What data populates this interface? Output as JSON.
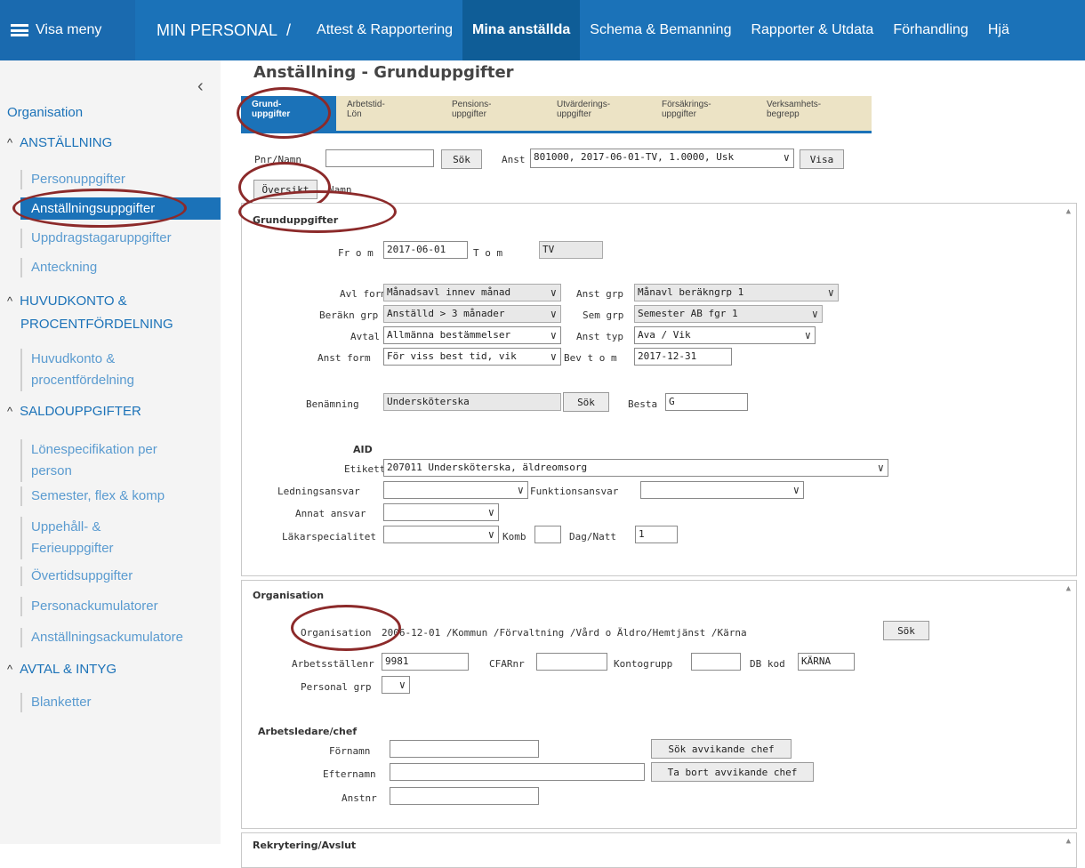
{
  "topbar": {
    "menu_label": "Visa meny",
    "app_title": "MIN PERSONAL",
    "separator": "/",
    "nav": [
      "Attest & Rapportering",
      "Mina anställda",
      "Schema & Bemanning",
      "Rapporter & Utdata",
      "Förhandling",
      "Hjä"
    ]
  },
  "sidebar": {
    "collapse": "‹",
    "organisation": "Organisation",
    "sec_anstallning": "ANSTÄLLNING",
    "personuppgifter": "Personuppgifter",
    "anstallningsuppgifter": "Anställningsuppgifter",
    "uppdragstagaruppgifter": "Uppdragstagaruppgifter",
    "anteckning": "Anteckning",
    "sec_huvudkonto_1": "HUVUDKONTO &",
    "sec_huvudkonto_2": "PROCENTFÖRDELNING",
    "huvudkonto_1": "Huvudkonto &",
    "huvudkonto_2": "procentfördelning",
    "sec_saldo": "SALDOUPPGIFTER",
    "lonespec_1": "Lönespecifikation per",
    "lonespec_2": "person",
    "semester": "Semester, flex & komp",
    "uppehall_1": "Uppehåll- &",
    "uppehall_2": "Ferieuppgifter",
    "overtid": "Övertidsuppgifter",
    "personack": "Personackumulatorer",
    "anstack": "Anställningsackumulatore",
    "sec_avtal": "AVTAL & INTYG",
    "blanketter": "Blanketter"
  },
  "page": {
    "title": "Anställning - Grunduppgifter",
    "tabs": [
      [
        "Grund-",
        "uppgifter"
      ],
      [
        "Arbetstid-",
        "Lön"
      ],
      [
        "Pensions-",
        "uppgifter"
      ],
      [
        "Utvärderings-",
        "uppgifter"
      ],
      [
        "Försäkrings-",
        "uppgifter"
      ],
      [
        "Verksamhets-",
        "begrepp"
      ]
    ],
    "pnr_label": "Pnr/Namn",
    "sok": "Sök",
    "anst_label": "Anst",
    "anst_value": "801000, 2017-06-01-TV, 1.0000, Usk",
    "visa": "Visa",
    "oversikt": "Översikt",
    "namn_label": "Namn"
  },
  "grund": {
    "header": "Grunduppgifter",
    "from_label": "Fr o m",
    "from_value": "2017-06-01",
    "tom_label": "T o m",
    "tom_value": "TV",
    "avl_form_label": "Avl form",
    "avl_form": "Månadsavl innev månad",
    "anst_grp_label": "Anst grp",
    "anst_grp": "Månavl beräkngrp 1",
    "berakn_label": "Beräkn grp",
    "berakn": "Anställd > 3 månader",
    "sem_grp_label": "Sem grp",
    "sem_grp": "Semester AB fgr 1",
    "avtal_label": "Avtal",
    "avtal": "Allmänna bestämmelser",
    "anst_typ_label": "Anst typ",
    "anst_typ": "Ava / Vik",
    "anst_form_label": "Anst form",
    "anst_form": "För viss best tid, vik",
    "bev_label": "Bev t o m",
    "bev_value": "2017-12-31",
    "benamning_label": "Benämning",
    "benamning": "Undersköterska",
    "besta_label": "Besta",
    "besta_value": "G",
    "aid_header": "AID",
    "etikett_label": "Etikett",
    "etikett": "207011 Undersköterska, äldreomsorg",
    "ledning_label": "Ledningsansvar",
    "funktion_label": "Funktionsansvar",
    "annat_label": "Annat ansvar",
    "lakar_label": "Läkarspecialitet",
    "komb_label": "Komb",
    "dagnatt_label": "Dag/Natt",
    "dagnatt_value": "1"
  },
  "org": {
    "header": "Organisation",
    "org_label": "Organisation",
    "org_value": "2006-12-01 /Kommun /Förvaltning /Vård o Äldro/Hemtjänst /Kärna",
    "arbetsst_label": "Arbetsställenr",
    "arbetsst_value": "9981",
    "cfar_label": "CFARnr",
    "kontogrupp_label": "Kontogrupp",
    "dbkod_label": "DB kod",
    "dbkod_value": "KÄRNA",
    "personal_label": "Personal grp",
    "chef_header": "Arbetsledare/chef",
    "fornamn_label": "Förnamn",
    "efternamn_label": "Efternamn",
    "anstnr_label": "Anstnr",
    "sok_chef": "Sök avvikande chef",
    "ta_bort_chef": "Ta bort avvikande chef"
  },
  "rekrytering": {
    "header": "Rekrytering/Avslut"
  }
}
